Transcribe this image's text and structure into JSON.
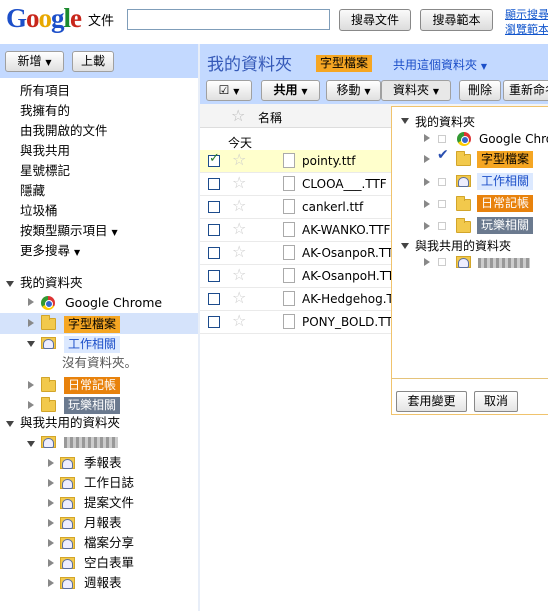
{
  "header": {
    "logo": {
      "p1": "G",
      "p2": "o",
      "p3": "o",
      "p4": "g",
      "p5": "l",
      "p6": "e"
    },
    "product": "文件",
    "search_value": "",
    "search_docs_button": "搜尋文件",
    "search_templates_button": "搜尋範本",
    "link_show_search_options": "顯示搜尋",
    "link_browse_templates": "瀏覽範本"
  },
  "sidebar": {
    "new_button": "新增",
    "upload_button": "上載",
    "nav": [
      "所有項目",
      "我擁有的",
      "由我開啟的文件",
      "與我共用",
      "星號標記",
      "隱藏",
      "垃圾桶",
      "按類型顯示項目",
      "更多搜尋"
    ],
    "my_folders": "我的資料夾",
    "folders": [
      {
        "name": "Google Chrome",
        "style": "plain"
      },
      {
        "name": "字型檔案",
        "style": "orange-tag",
        "selected": true
      },
      {
        "name": "工作相關",
        "style": "blue-tag"
      },
      {
        "name": "日常記帳",
        "style": "orange-dark-tag"
      },
      {
        "name": "玩樂相關",
        "style": "gray-tag"
      }
    ],
    "no_subfolders": "沒有資料夾。",
    "shared_folders": "與我共用的資料夾",
    "shared_sub": [
      "季報表",
      "工作日誌",
      "提案文件",
      "月報表",
      "檔案分享",
      "空白表單",
      "週報表"
    ]
  },
  "main": {
    "breadcrumb_root": "我的資料夾",
    "current_folder": "字型檔案",
    "share_folder": "共用這個資料夾",
    "toolbar": {
      "share": "共用",
      "move": "移動",
      "folder": "資料夾",
      "delete": "刪除",
      "rename": "重新命名"
    },
    "column_name": "名稱",
    "group_today": "今天",
    "files": [
      {
        "name": "pointy.ttf",
        "checked": true
      },
      {
        "name": "CLOOA___.TTF",
        "checked": false
      },
      {
        "name": "cankerl.ttf",
        "checked": false
      },
      {
        "name": "AK-WANKO.TTF",
        "checked": false
      },
      {
        "name": "AK-OsanpoR.TTF",
        "checked": false
      },
      {
        "name": "AK-OsanpoH.TTF",
        "checked": false
      },
      {
        "name": "AK-Hedgehog.TTF",
        "checked": false
      },
      {
        "name": "PONY_BOLD.TTF",
        "checked": false
      }
    ]
  },
  "folder_popup": {
    "my_folders": "我的資料夾",
    "items": [
      "Google Chrome",
      "字型檔案",
      "工作相關",
      "日常記帳",
      "玩樂相關"
    ],
    "shared": "與我共用的資料夾",
    "apply_button": "套用變更",
    "cancel_button": "取消"
  },
  "colors": {
    "accent": "#3559b8",
    "header_bg": "#c3d9ff",
    "selected_row": "#ffffcc",
    "tag_orange": "#f5a623",
    "tag_blue": "#dce9ff",
    "tag_orange_dark": "#e8820c",
    "tag_gray": "#6b7a8f"
  }
}
